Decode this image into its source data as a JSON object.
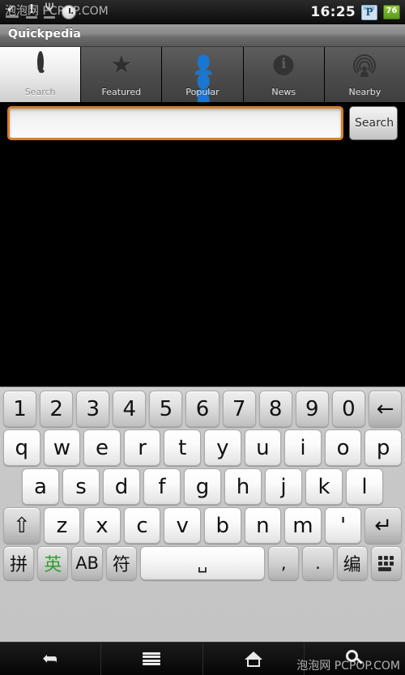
{
  "status_bar": {
    "time": "16:25",
    "battery_level": "76",
    "left_icons": [
      "checkmark-sync-icon",
      "warning-icon",
      "usb-icon",
      "alarm-clock-icon"
    ],
    "right_icons": [
      "pcpop-app-icon",
      "battery-icon"
    ]
  },
  "title_bar": {
    "title": "Quickpedia"
  },
  "tabs": [
    {
      "label": "Search",
      "icon": "search-icon",
      "active": true
    },
    {
      "label": "Featured",
      "icon": "star-icon",
      "active": false
    },
    {
      "label": "Popular",
      "icon": "people-icon",
      "active": false
    },
    {
      "label": "News",
      "icon": "info-icon",
      "active": false
    },
    {
      "label": "Nearby",
      "icon": "nearby-radar-icon",
      "active": false
    }
  ],
  "search": {
    "value": "",
    "placeholder": "",
    "button_label": "Search",
    "focus_color": "#d5812a"
  },
  "keyboard": {
    "row1": [
      "1",
      "2",
      "3",
      "4",
      "5",
      "6",
      "7",
      "8",
      "9",
      "0"
    ],
    "backspace": "←",
    "row2": [
      "q",
      "w",
      "e",
      "r",
      "t",
      "y",
      "u",
      "i",
      "o",
      "p"
    ],
    "row3": [
      "a",
      "s",
      "d",
      "f",
      "g",
      "h",
      "j",
      "k",
      "l"
    ],
    "shift": "⇧",
    "row4": [
      "z",
      "x",
      "c",
      "v",
      "b",
      "n",
      "m",
      "'"
    ],
    "enter": "↵",
    "row5": {
      "pinyin": "拼",
      "english": "英",
      "ab": "AB",
      "symbol": "符",
      "space": "␣",
      "comma": ",",
      "period": ".",
      "edit": "编",
      "keypad": "keypad-grid-icon"
    },
    "active_input_mode": "英",
    "active_mode_color": "#2f9e2f"
  },
  "nav_bar": [
    {
      "name": "back",
      "icon": "back-arrow-icon"
    },
    {
      "name": "menu",
      "icon": "hamburger-menu-icon"
    },
    {
      "name": "home",
      "icon": "home-icon"
    },
    {
      "name": "search",
      "icon": "search-icon"
    }
  ],
  "watermark": {
    "top": "泡泡网  PCPOP.COM",
    "bottom": "泡泡网  PCPOP.COM"
  }
}
